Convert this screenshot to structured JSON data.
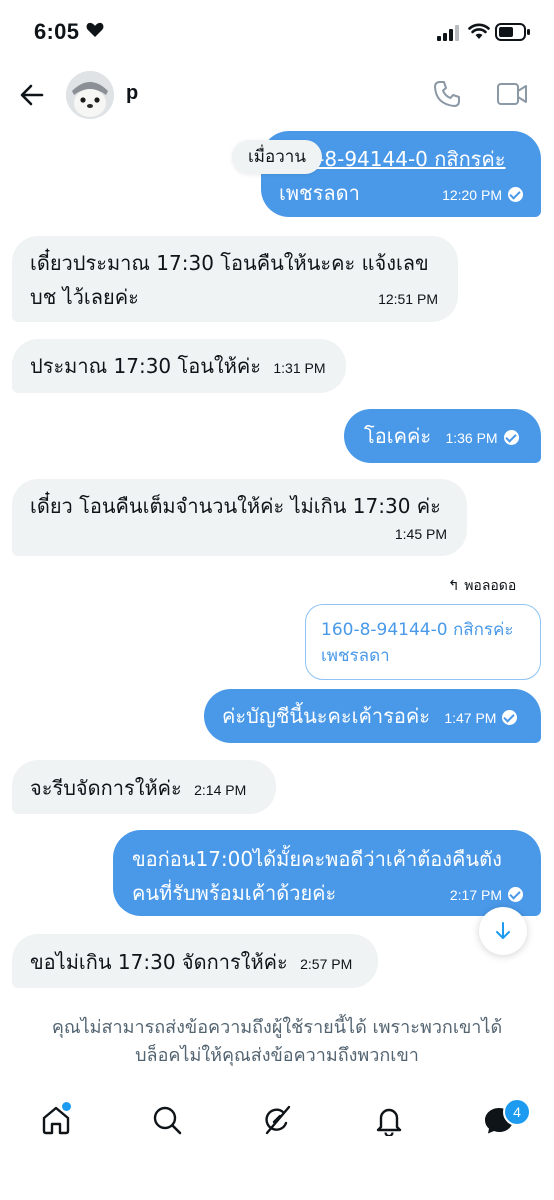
{
  "status": {
    "time": "6:05"
  },
  "header": {
    "contact_name": "p"
  },
  "yesterday_label": "เมื่อวาน",
  "messages": [
    {
      "line1": "160-8-94144-0 กสิกรค่ะ",
      "line2": "เพชรลดา",
      "time": "12:20 PM"
    },
    {
      "line1": "เดี๋ยวประมาณ 17:30 โอนคืนให้นะคะ แจ้งเลข",
      "line2": "บช ไว้เลยค่ะ",
      "time": "12:51 PM"
    },
    {
      "text": "ประมาณ 17:30 โอนให้ค่ะ",
      "time": "1:31 PM"
    },
    {
      "text": "โอเคค่ะ",
      "time": "1:36 PM"
    },
    {
      "text": "เดี๋ยว โอนคืนเต็มจำนวนให้ค่ะ ไม่เกิน 17:30 ค่ะ",
      "time": "1:45 PM"
    },
    {
      "text": "ค่ะบัญชีนี้นะคะเค้ารอค่ะ",
      "time": "1:47 PM"
    },
    {
      "text": "จะรีบจัดการให้ค่ะ",
      "time": "2:14 PM"
    },
    {
      "line1": "ขอก่อน17:00ได้มั้ยคะพอดีว่าเค้าต้องคืนตัง",
      "line2": "คนที่รับพร้อมเค้าด้วยค่ะ",
      "time": "2:17 PM"
    },
    {
      "text": "ขอไม่เกิน 17:30 จัดการให้ค่ะ",
      "time": "2:57 PM"
    }
  ],
  "reply": {
    "label": "พอลอดอ",
    "quoted_line1": "160-8-94144-0 กสิกรค่ะ",
    "quoted_line2": "เพชรลดา"
  },
  "blocked_notice": {
    "line1": "คุณไม่สามารถส่งข้อความถึงผู้ใช้รายนี้ได้ เพราะพวกเขาได้",
    "line2": "บล็อคไม่ให้คุณส่งข้อความถึงพวกเขา"
  },
  "nav": {
    "items": [
      "home-icon",
      "search-icon",
      "grok-icon",
      "notifications-icon",
      "messages-icon"
    ],
    "messages_badge": "4"
  },
  "colors": {
    "accent": "#1d9bf0",
    "outgoing_bubble": "#4a99e9",
    "incoming_bubble": "#eff3f4"
  }
}
